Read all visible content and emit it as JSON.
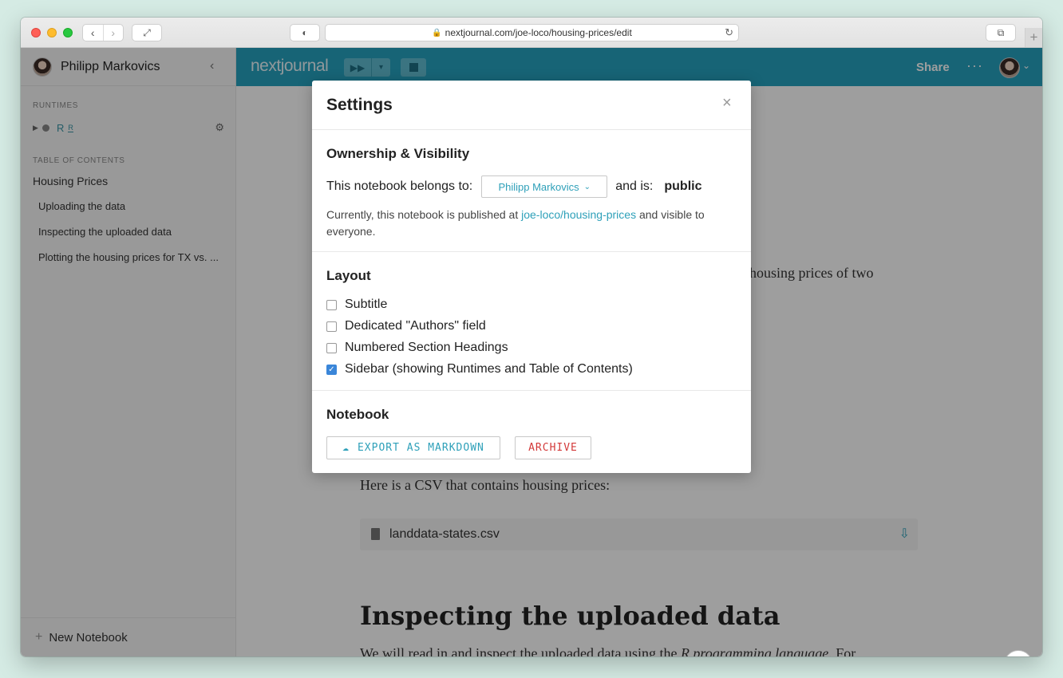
{
  "browser": {
    "url": "nextjournal.com/joe-loco/housing-prices/edit"
  },
  "sidebar": {
    "user_name": "Philipp Markovics",
    "runtimes_heading": "RUNTIMES",
    "runtime": {
      "name": "R",
      "lang_badge": "R"
    },
    "toc_heading": "TABLE OF CONTENTS",
    "toc": [
      "Housing Prices",
      "Uploading the data",
      "Inspecting the uploaded data",
      "Plotting the housing prices for TX vs. ..."
    ],
    "new_notebook": "New Notebook"
  },
  "topbar": {
    "logo": "nextjournal",
    "share": "Share",
    "more": "···"
  },
  "content": {
    "intro_tail": "housing prices of two",
    "csv_para": "Here is a CSV that contains housing prices:",
    "file_name": "landdata-states.csv",
    "section_heading": "Inspecting the uploaded data",
    "body_start": "We will read in and inspect the uploaded data using the ",
    "body_em": "R programming language",
    "body_end": ". For"
  },
  "help": "?",
  "modal": {
    "title": "Settings",
    "close": "×",
    "ownership": {
      "heading": "Ownership & Visibility",
      "belongs_label": "This notebook belongs to:",
      "owner": "Philipp Markovics",
      "and_is": "and is:",
      "visibility": "public",
      "note_pre": "Currently, this notebook is published at ",
      "note_link": "joe-loco/housing-prices",
      "note_post": " and visible to everyone."
    },
    "layout": {
      "heading": "Layout",
      "options": [
        {
          "label": "Subtitle",
          "checked": false
        },
        {
          "label": "Dedicated \"Authors\" field",
          "checked": false
        },
        {
          "label": "Numbered Section Headings",
          "checked": false
        },
        {
          "label": "Sidebar (showing Runtimes and Table of Contents)",
          "checked": true
        }
      ]
    },
    "notebook": {
      "heading": "Notebook",
      "export": "EXPORT AS MARKDOWN",
      "archive": "ARCHIVE"
    }
  },
  "colors": {
    "brand": "#26a2bf",
    "link": "#2ea0b9",
    "danger": "#d33a3a",
    "checkbox": "#3a86d9"
  }
}
